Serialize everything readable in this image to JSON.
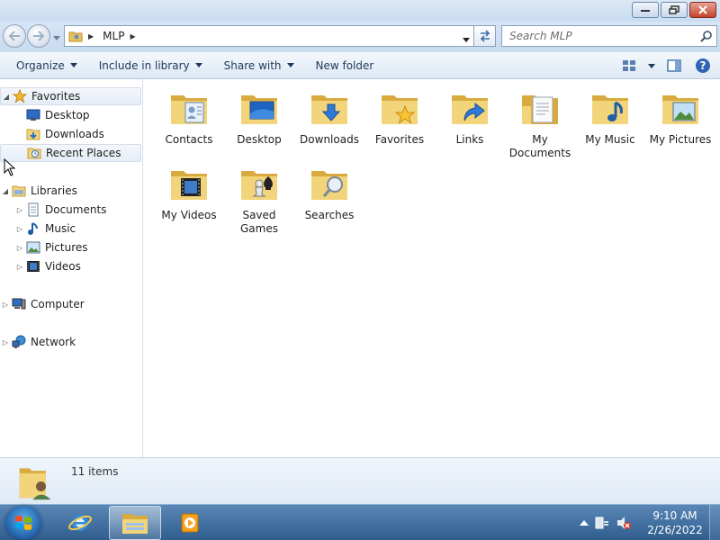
{
  "window": {
    "path": [
      "MLP"
    ],
    "search_placeholder": "Search MLP"
  },
  "toolbar": {
    "organize": "Organize",
    "include_in_library": "Include in library",
    "share_with": "Share with",
    "new_folder": "New folder"
  },
  "nav": {
    "favorites": {
      "label": "Favorites",
      "items": [
        {
          "label": "Desktop",
          "icon": "desktop-icon"
        },
        {
          "label": "Downloads",
          "icon": "downloads-icon"
        },
        {
          "label": "Recent Places",
          "icon": "recent-places-icon"
        }
      ]
    },
    "libraries": {
      "label": "Libraries",
      "items": [
        {
          "label": "Documents",
          "icon": "documents-icon"
        },
        {
          "label": "Music",
          "icon": "music-icon"
        },
        {
          "label": "Pictures",
          "icon": "pictures-icon"
        },
        {
          "label": "Videos",
          "icon": "videos-icon"
        }
      ]
    },
    "computer": {
      "label": "Computer"
    },
    "network": {
      "label": "Network"
    }
  },
  "folders": [
    {
      "label": "Contacts",
      "overlay": "contacts"
    },
    {
      "label": "Desktop",
      "overlay": "desktop"
    },
    {
      "label": "Downloads",
      "overlay": "downloads"
    },
    {
      "label": "Favorites",
      "overlay": "favorites"
    },
    {
      "label": "Links",
      "overlay": "links"
    },
    {
      "label": "My Documents",
      "overlay": "documents"
    },
    {
      "label": "My Music",
      "overlay": "music"
    },
    {
      "label": "My Pictures",
      "overlay": "pictures"
    },
    {
      "label": "My Videos",
      "overlay": "videos"
    },
    {
      "label": "Saved Games",
      "overlay": "games"
    },
    {
      "label": "Searches",
      "overlay": "searches"
    }
  ],
  "details": {
    "item_count": "11 items"
  },
  "taskbar": {
    "time": "9:10 AM",
    "date": "2/26/2022"
  },
  "colors": {
    "folder": "#f2d47a",
    "folder_dark": "#d9ab3f",
    "accent": "#1e395b"
  }
}
